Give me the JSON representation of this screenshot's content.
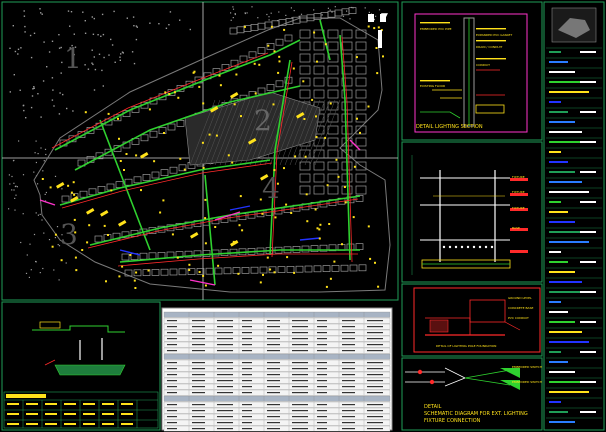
{
  "sheet": {
    "zone_labels": [
      "1",
      "2",
      "3",
      "4"
    ],
    "nav_arrows": [
      "▲",
      "▼"
    ]
  },
  "detail_lighting_section": {
    "title": "DETAIL LIGHTING SECTION",
    "labels": [
      "EMBEDDED PVC PIPE",
      "EXPANDED PVC GASKET",
      "DRAIN / CONDUIT",
      "CONDUIT",
      "EXISTING FLOOR"
    ]
  },
  "detail_pole": {
    "labels": [
      "FIXTURE",
      "FIXTURE",
      "FIXTURE",
      "BASE"
    ]
  },
  "detail_red": {
    "labels": [
      "GROUND LEVEL",
      "CONCRETE BASE",
      "PVC CONDUIT"
    ],
    "footnote": "DETAIL OF LIGHTING POLE FOUNDATION"
  },
  "schematic": {
    "title_line1": "DETAIL",
    "title_line2": "SCHEMATIC DIAGRAM FOR EXT. LIGHTING",
    "title_line3": "FIXTURE CONNECTION",
    "labels": [
      "EMBEDDED SWITCH",
      "EMBEDDED SWITCH"
    ]
  },
  "colors": {
    "border": "#1f9e57",
    "road": "#2fd12f",
    "building": "#8a8a8a",
    "fixture": "#ffe21a",
    "conduit": "#ff2a2a",
    "magenta": "#ff33cc",
    "blue": "#2233ff",
    "white": "#ffffff"
  }
}
